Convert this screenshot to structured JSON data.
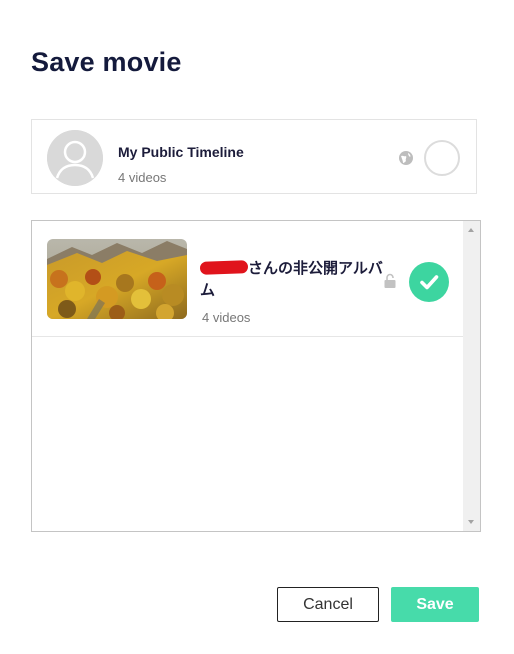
{
  "dialog": {
    "title": "Save movie"
  },
  "public_timeline": {
    "name": "My Public Timeline",
    "count": "4 videos",
    "privacy_icon": "globe-icon",
    "selected": false
  },
  "albums": [
    {
      "title_suffix": "さんの非公開アルバム",
      "count": "4 videos",
      "privacy_icon": "lock-icon",
      "selected": true
    }
  ],
  "buttons": {
    "cancel": "Cancel",
    "save": "Save"
  },
  "colors": {
    "accent": "#47dbaa",
    "check": "#3dd5a0",
    "title": "#141a3c",
    "redaction": "#e0141c"
  }
}
